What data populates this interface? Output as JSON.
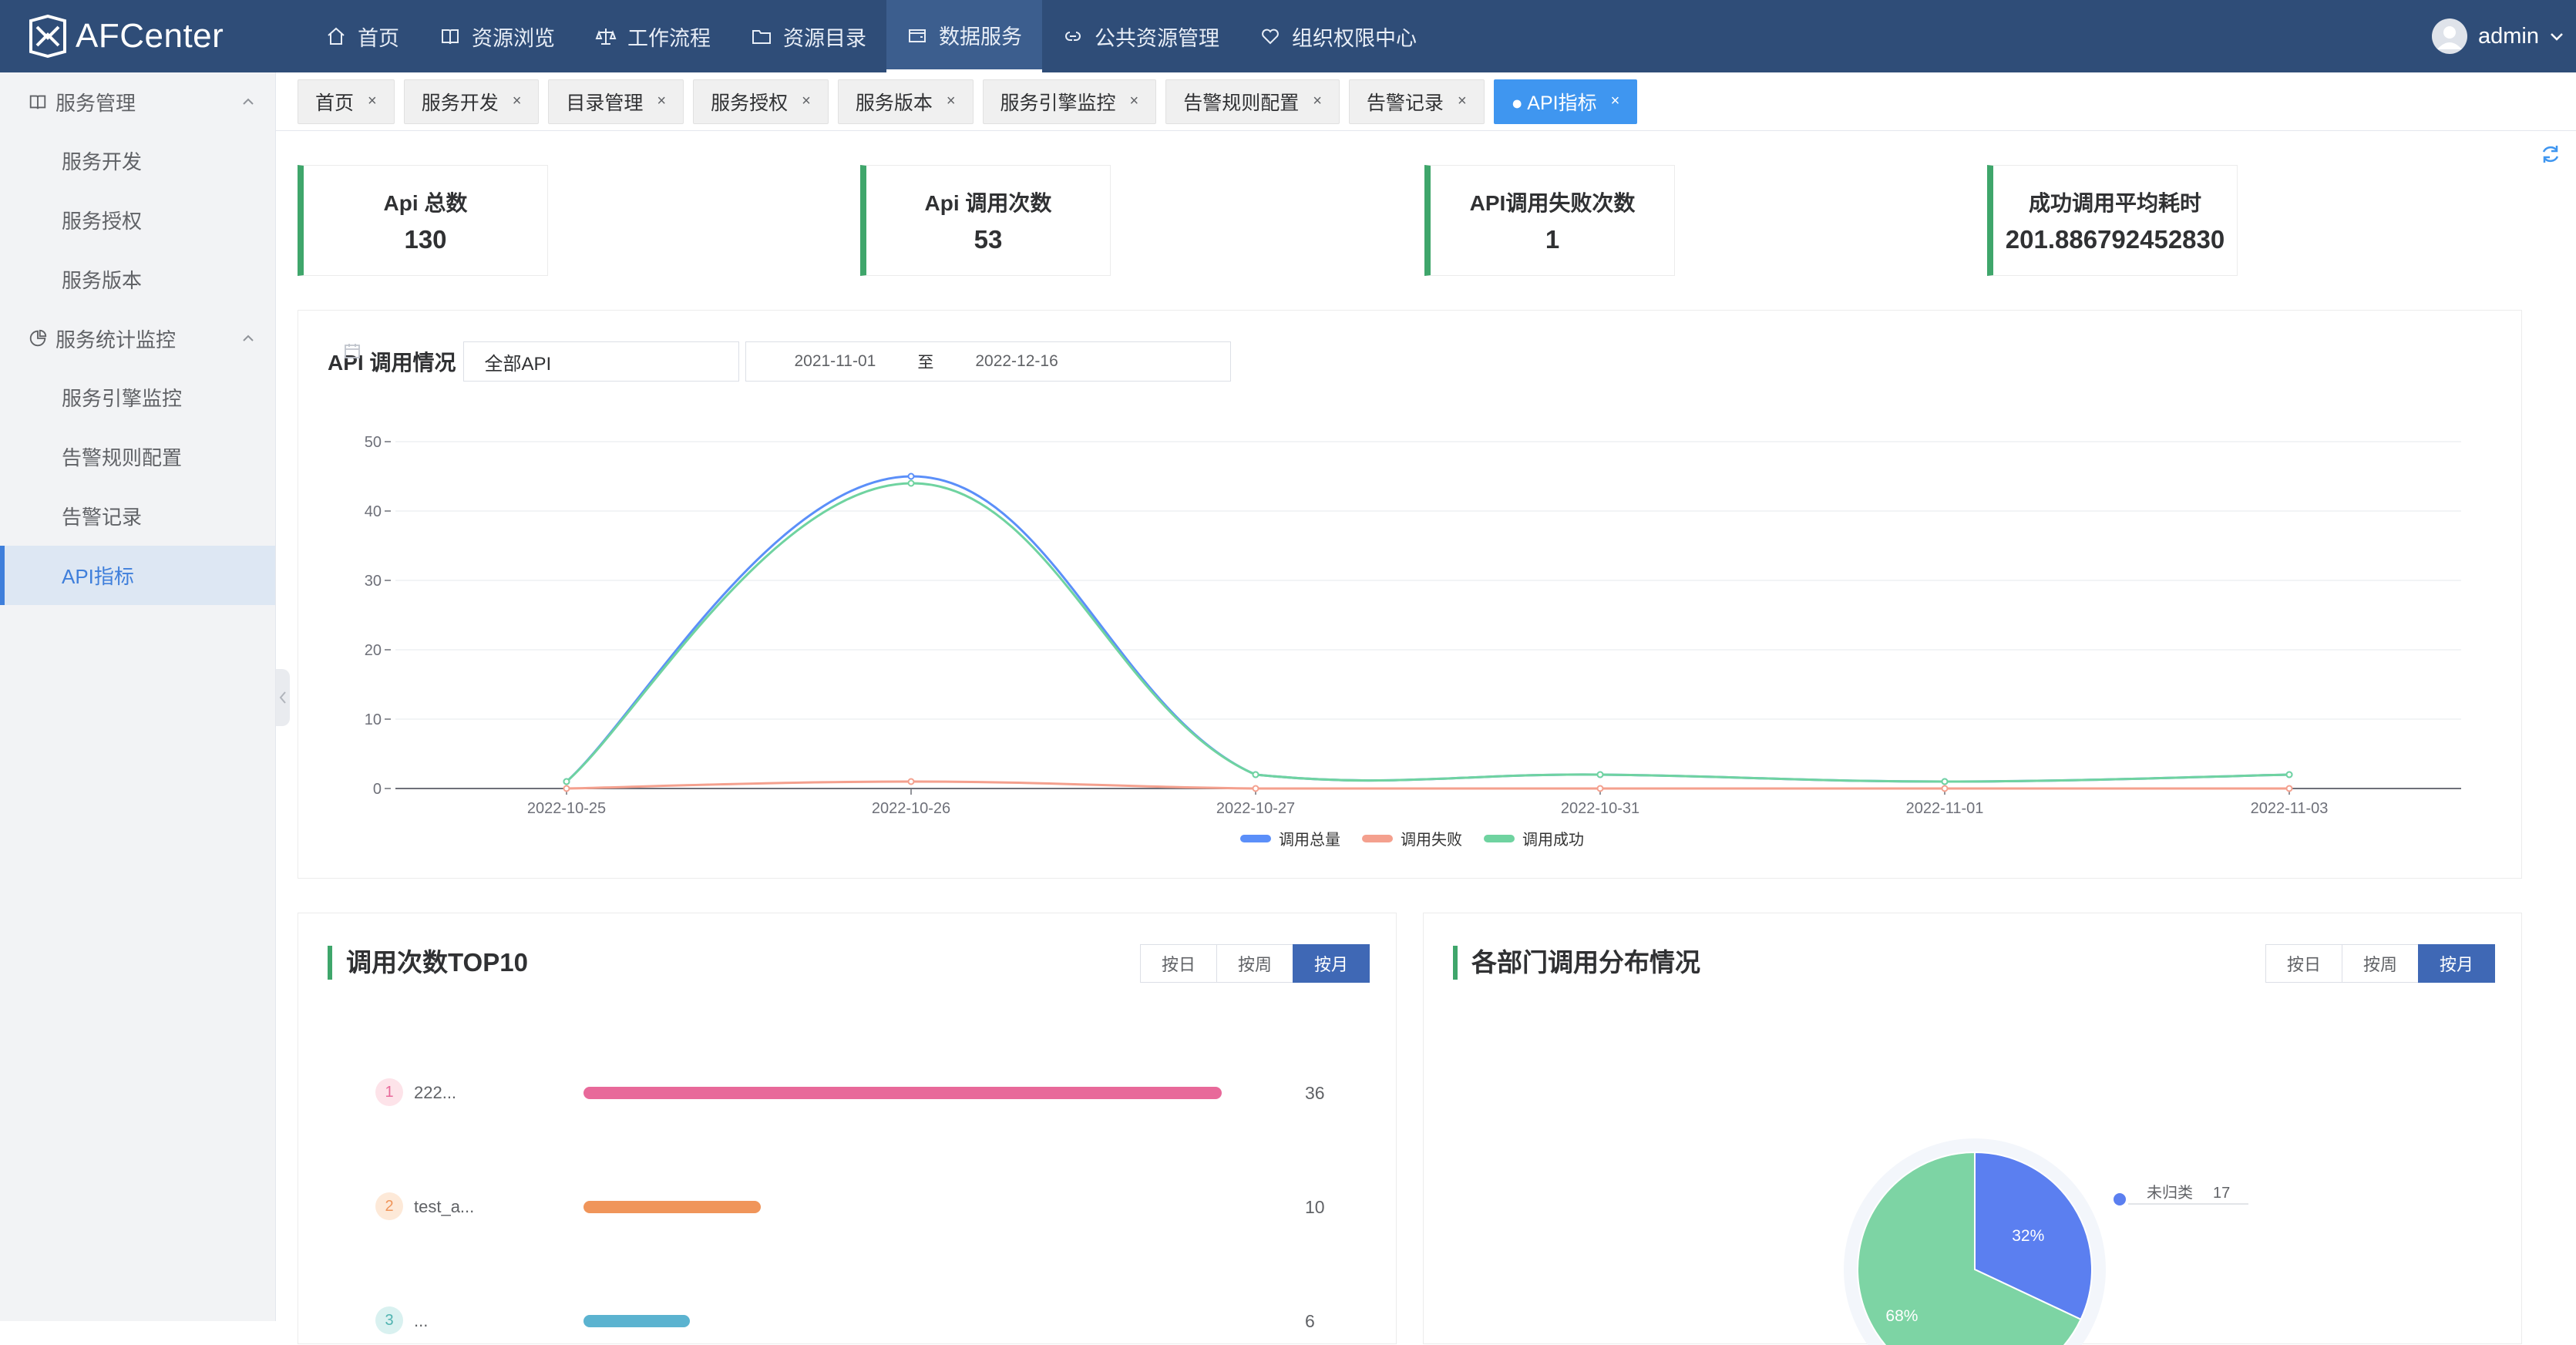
{
  "app": {
    "name": "AFCenter"
  },
  "nav": [
    {
      "label": "首页",
      "icon": "home-icon"
    },
    {
      "label": "资源浏览",
      "icon": "book-icon"
    },
    {
      "label": "工作流程",
      "icon": "scale-icon"
    },
    {
      "label": "资源目录",
      "icon": "folder-icon"
    },
    {
      "label": "数据服务",
      "icon": "wallet-icon",
      "active": true
    },
    {
      "label": "公共资源管理",
      "icon": "link-icon"
    },
    {
      "label": "组织权限中心",
      "icon": "heart-icon"
    }
  ],
  "user": {
    "name": "admin"
  },
  "sidebar": {
    "groups": [
      {
        "label": "服务管理",
        "icon": "book-icon",
        "items": [
          "服务开发",
          "服务授权",
          "服务版本"
        ]
      },
      {
        "label": "服务统计监控",
        "icon": "pie-chart-icon",
        "items": [
          "服务引擎监控",
          "告警规则配置",
          "告警记录",
          "API指标"
        ]
      }
    ],
    "active_item": "API指标"
  },
  "tabs": [
    {
      "label": "首页"
    },
    {
      "label": "服务开发"
    },
    {
      "label": "目录管理"
    },
    {
      "label": "服务授权"
    },
    {
      "label": "服务版本"
    },
    {
      "label": "服务引擎监控"
    },
    {
      "label": "告警规则配置"
    },
    {
      "label": "告警记录"
    },
    {
      "label": "● API指标",
      "active": true
    }
  ],
  "tab_close": "×",
  "stats": [
    {
      "label": "Api 总数",
      "value": "130"
    },
    {
      "label": "Api 调用次数",
      "value": "53"
    },
    {
      "label": "API调用失败次数",
      "value": "1"
    },
    {
      "label": "成功调用平均耗时",
      "value": "201.886792452830"
    }
  ],
  "trend": {
    "title": "API 调用情况",
    "api_select": "全部API",
    "date_start": "2021-11-01",
    "date_sep": "至",
    "date_end": "2022-12-16"
  },
  "chart_data": {
    "type": "line",
    "x": [
      "2022-10-25",
      "2022-10-26",
      "2022-10-27",
      "2022-10-31",
      "2022-11-01",
      "2022-11-03"
    ],
    "series": [
      {
        "name": "调用总量",
        "values": [
          1,
          45,
          2,
          2,
          1,
          2
        ],
        "color": "#5b8ff9"
      },
      {
        "name": "调用失败",
        "values": [
          0,
          1,
          0,
          0,
          0,
          0
        ],
        "color": "#f4a08e"
      },
      {
        "name": "调用成功",
        "values": [
          1,
          44,
          2,
          2,
          1,
          2
        ],
        "color": "#6fd3a0"
      }
    ],
    "ylim": [
      0,
      50
    ],
    "yticks": [
      0,
      10,
      20,
      30,
      40,
      50
    ],
    "grid": true,
    "legend": "bottom-center",
    "smooth": true
  },
  "top10": {
    "title": "调用次数TOP10",
    "segments": [
      "按日",
      "按周",
      "按月"
    ],
    "active_segment": "按月",
    "max": 36,
    "rows": [
      {
        "rank": "1",
        "name": "222...",
        "value": 36,
        "color": "#e8699a",
        "badge_bg": "#fde3e9",
        "badge_fg": "#e8699a"
      },
      {
        "rank": "2",
        "name": "test_a...",
        "value": 10,
        "color": "#f0955a",
        "badge_bg": "#fde9d8",
        "badge_fg": "#f0955a"
      },
      {
        "rank": "3",
        "name": "...",
        "value": 6,
        "color": "#5bb3d0",
        "badge_bg": "#d9f1f0",
        "badge_fg": "#4fb3b0"
      }
    ]
  },
  "dept": {
    "title": "各部门调用分布情况",
    "segments": [
      "按日",
      "按周",
      "按月"
    ],
    "active_segment": "按月",
    "slices": [
      {
        "label": "32%",
        "percent": 32,
        "color": "#5b7ff0"
      },
      {
        "label": "68%",
        "percent": 68,
        "color": "#7dd4a4"
      }
    ],
    "legend": {
      "label": "未归类",
      "value": "17",
      "color": "#5b7ff0"
    }
  }
}
